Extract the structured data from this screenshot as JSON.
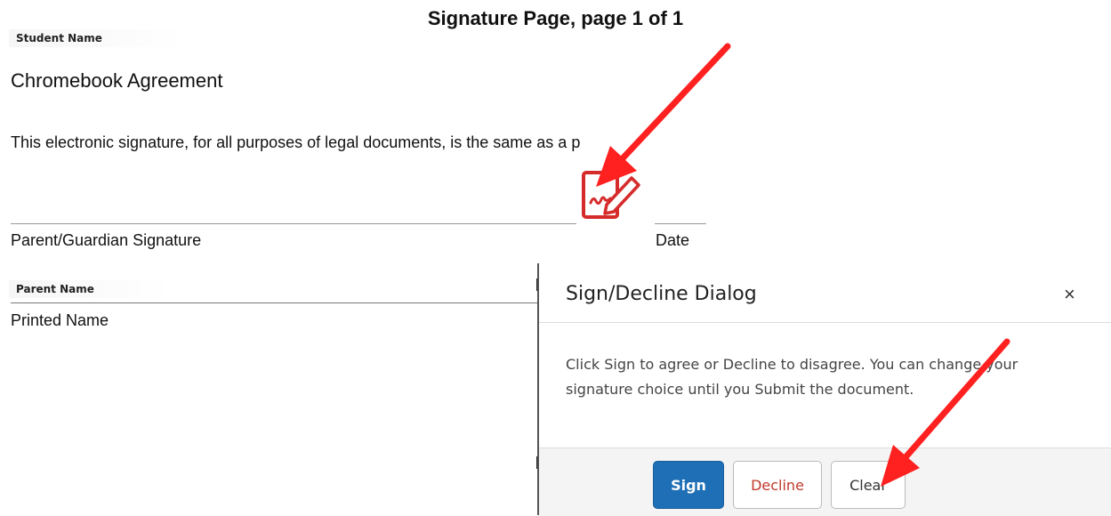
{
  "page": {
    "title": "Signature Page, page 1 of 1",
    "student_name_label": "Student Name",
    "document_title": "Chromebook Agreement",
    "body_text": "This electronic signature, for all purposes of legal documents, is the same as a p",
    "signature_label": "Parent/Guardian Signature",
    "date_label": "Date",
    "parent_name_label": "Parent Name",
    "printed_name_label": "Printed Name"
  },
  "icons": {
    "signature": "sign-document-icon",
    "close": "close-icon",
    "annotation": "red-arrow"
  },
  "dialog": {
    "title": "Sign/Decline Dialog",
    "close_label": "×",
    "message": "Click Sign to agree or Decline to disagree. You can change your signature choice until you Submit the document.",
    "buttons": {
      "sign": "Sign",
      "decline": "Decline",
      "clear": "Clear"
    }
  },
  "colors": {
    "accent": "#1e6fb6",
    "decline_text": "#c0392b",
    "icon": "#d62b2b",
    "arrow": "#ff2020"
  }
}
